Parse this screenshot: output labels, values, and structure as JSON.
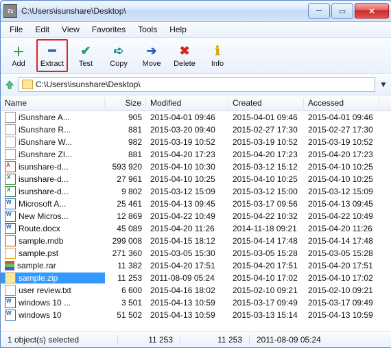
{
  "window": {
    "title": "C:\\Users\\isunshare\\Desktop\\",
    "app_icon": "7z"
  },
  "menu": [
    "File",
    "Edit",
    "View",
    "Favorites",
    "Tools",
    "Help"
  ],
  "toolbar": [
    {
      "id": "add",
      "label": "Add",
      "glyph": "＋",
      "color": "#3a9a3a"
    },
    {
      "id": "extract",
      "label": "Extract",
      "glyph": "━",
      "color": "#2a5fbb",
      "highlight": true
    },
    {
      "id": "test",
      "label": "Test",
      "glyph": "✔",
      "color": "#2a9a6a"
    },
    {
      "id": "copy",
      "label": "Copy",
      "glyph": "➪",
      "color": "#1a8a8a"
    },
    {
      "id": "move",
      "label": "Move",
      "glyph": "➔",
      "color": "#2a5fbb"
    },
    {
      "id": "delete",
      "label": "Delete",
      "glyph": "✖",
      "color": "#cc2a2a"
    },
    {
      "id": "info",
      "label": "Info",
      "glyph": "ℹ",
      "color": "#d9a500"
    }
  ],
  "address": "C:\\Users\\isunshare\\Desktop\\",
  "columns": [
    "Name",
    "Size",
    "Modified",
    "Created",
    "Accessed"
  ],
  "files": [
    {
      "icon": "txt",
      "name": "iSunshare A...",
      "size": "905",
      "mod": "2015-04-01 09:46",
      "crt": "2015-04-01 09:46",
      "acc": "2015-04-01 09:46"
    },
    {
      "icon": "txt",
      "name": "iSunshare R...",
      "size": "881",
      "mod": "2015-03-20 09:40",
      "crt": "2015-02-27 17:30",
      "acc": "2015-02-27 17:30"
    },
    {
      "icon": "txt",
      "name": "iSunshare W...",
      "size": "982",
      "mod": "2015-03-19 10:52",
      "crt": "2015-03-19 10:52",
      "acc": "2015-03-19 10:52"
    },
    {
      "icon": "txt",
      "name": "iSunshare ZI...",
      "size": "881",
      "mod": "2015-04-20 17:23",
      "crt": "2015-04-20 17:23",
      "acc": "2015-04-20 17:23"
    },
    {
      "icon": "pdf",
      "name": "isunshare-d...",
      "size": "593 920",
      "mod": "2015-04-10 10:30",
      "crt": "2015-03-12 15:12",
      "acc": "2015-04-10 10:25"
    },
    {
      "icon": "xls",
      "name": "isunshare-d...",
      "size": "27 961",
      "mod": "2015-04-10 10:25",
      "crt": "2015-04-10 10:25",
      "acc": "2015-04-10 10:25"
    },
    {
      "icon": "xls",
      "name": "isunshare-d...",
      "size": "9 802",
      "mod": "2015-03-12 15:09",
      "crt": "2015-03-12 15:00",
      "acc": "2015-03-12 15:09"
    },
    {
      "icon": "doc",
      "name": "Microsoft A...",
      "size": "25 461",
      "mod": "2015-04-13 09:45",
      "crt": "2015-03-17 09:56",
      "acc": "2015-04-13 09:45"
    },
    {
      "icon": "doc",
      "name": "New Micros...",
      "size": "12 869",
      "mod": "2015-04-22 10:49",
      "crt": "2015-04-22 10:32",
      "acc": "2015-04-22 10:49"
    },
    {
      "icon": "doc",
      "name": "Route.docx",
      "size": "45 089",
      "mod": "2015-04-20 11:26",
      "crt": "2014-11-18 09:21",
      "acc": "2015-04-20 11:26"
    },
    {
      "icon": "mdb",
      "name": "sample.mdb",
      "size": "299 008",
      "mod": "2015-04-15 18:12",
      "crt": "2015-04-14 17:48",
      "acc": "2015-04-14 17:48"
    },
    {
      "icon": "pst",
      "name": "sample.pst",
      "size": "271 360",
      "mod": "2015-03-05 15:30",
      "crt": "2015-03-05 15:28",
      "acc": "2015-03-05 15:28"
    },
    {
      "icon": "rar",
      "name": "sample.rar",
      "size": "11 382",
      "mod": "2015-04-20 17:51",
      "crt": "2015-04-20 17:51",
      "acc": "2015-04-20 17:51"
    },
    {
      "icon": "zip",
      "name": "sample.zip",
      "size": "11 253",
      "mod": "2011-08-09 05:24",
      "crt": "2015-04-10 17:02",
      "acc": "2015-04-10 17:02",
      "selected": true
    },
    {
      "icon": "txt",
      "name": "user review.txt",
      "size": "6 600",
      "mod": "2015-04-16 18:02",
      "crt": "2015-02-10 09:21",
      "acc": "2015-02-10 09:21"
    },
    {
      "icon": "doc",
      "name": "windows 10 ...",
      "size": "3 501",
      "mod": "2015-04-13 10:59",
      "crt": "2015-03-17 09:49",
      "acc": "2015-03-17 09:49"
    },
    {
      "icon": "doc",
      "name": "windows 10",
      "size": "51 502",
      "mod": "2015-04-13 10:59",
      "crt": "2015-03-13 15:14",
      "acc": "2015-04-13 10:59"
    }
  ],
  "status": {
    "selected": "1 object(s) selected",
    "size1": "11 253",
    "size2": "11 253",
    "date": "2011-08-09 05:24"
  }
}
